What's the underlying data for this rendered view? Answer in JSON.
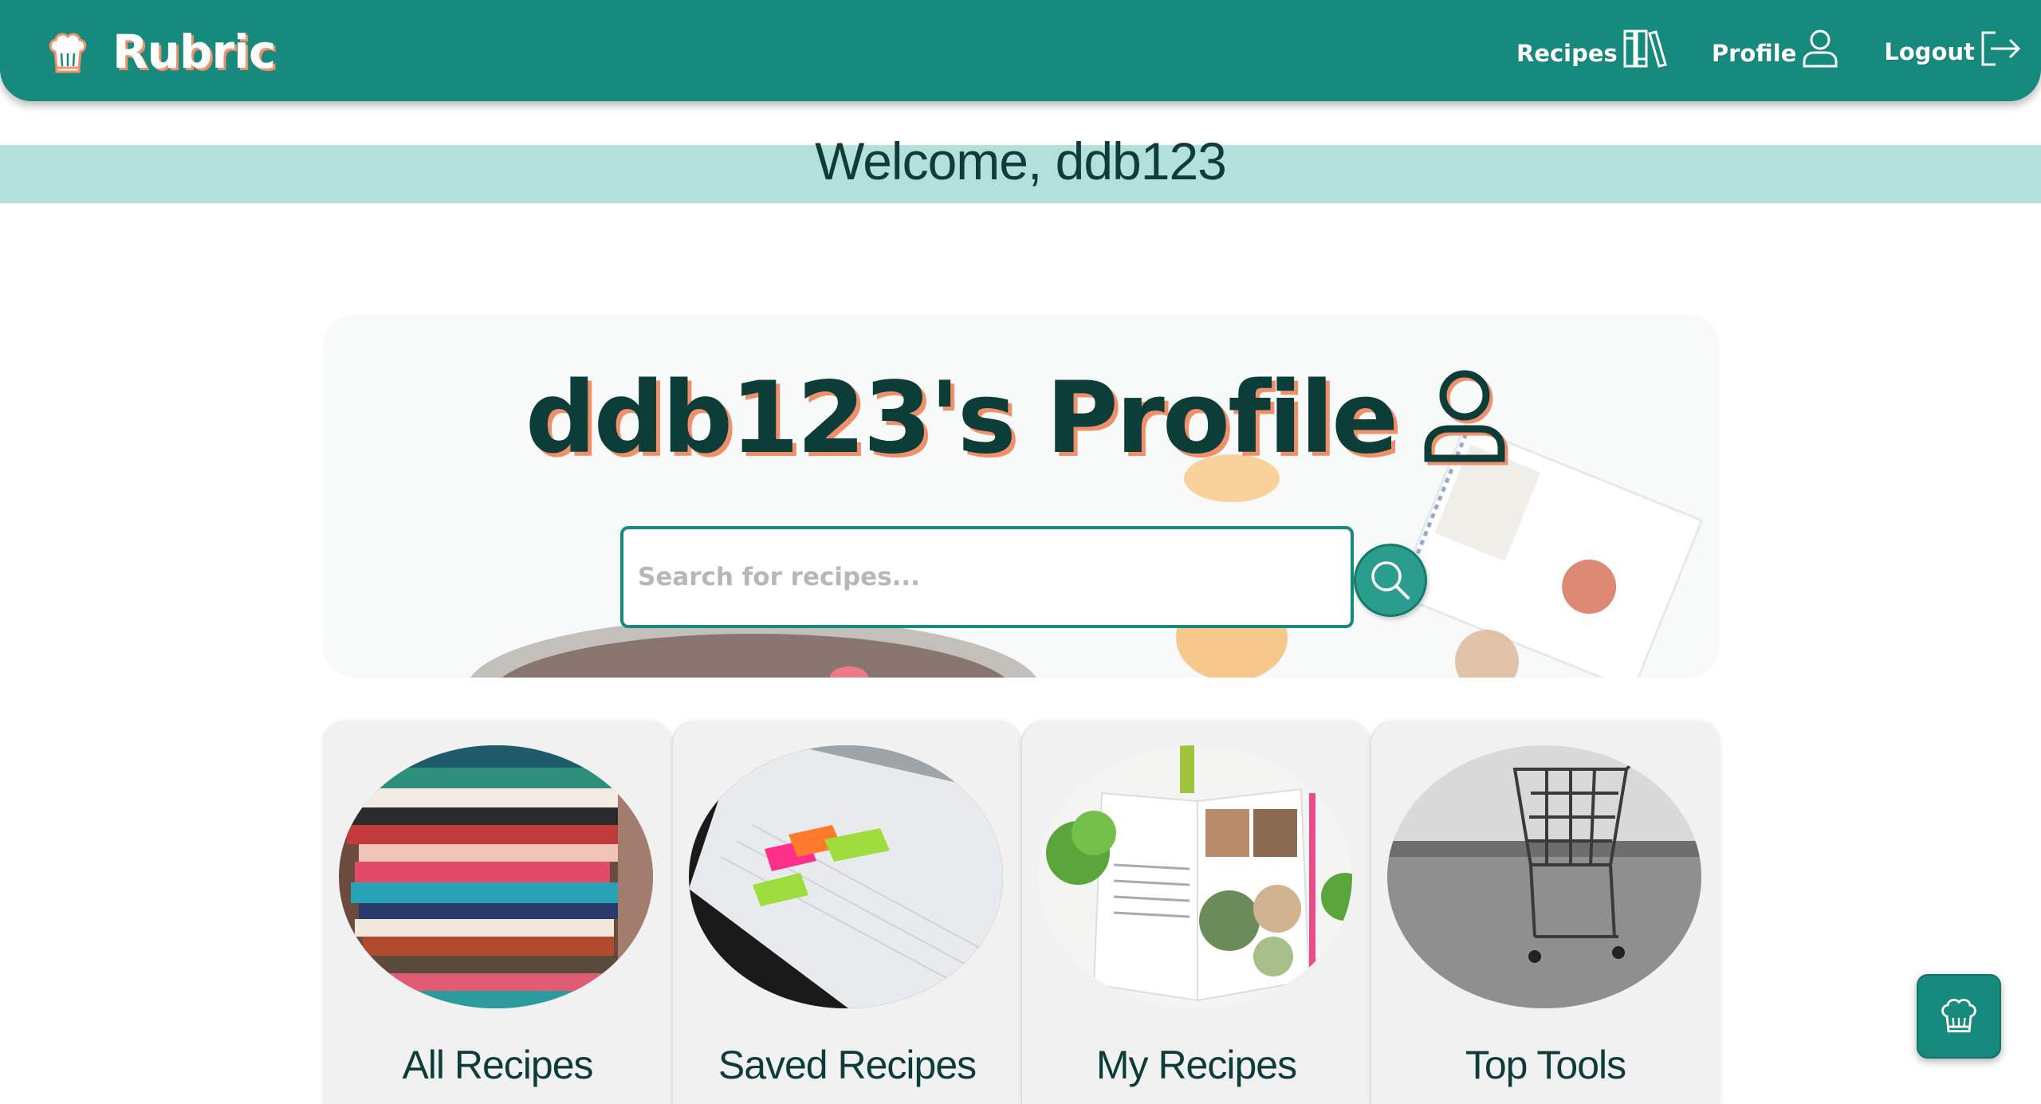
{
  "app": {
    "name": "Rubric",
    "logo_icon": "chef-hat-icon"
  },
  "nav": {
    "recipes_label": "Recipes",
    "profile_label": "Profile",
    "logout_label": "Logout"
  },
  "welcome": {
    "text": "Welcome, ddb123"
  },
  "profile": {
    "title": "ddb123's Profile",
    "search_placeholder": "Search for recipes..."
  },
  "cards": [
    {
      "label": "All Recipes",
      "image": "cookbook-stack"
    },
    {
      "label": "Saved Recipes",
      "image": "bookmarked-pages"
    },
    {
      "label": "My Recipes",
      "image": "open-cookbook"
    },
    {
      "label": "Top Tools",
      "image": "shopping-cart"
    }
  ],
  "colors": {
    "primary": "#168a7d",
    "dark_text": "#0d3d39",
    "accent_shadow": "#f0906a",
    "welcome_bar": "#b4e0db"
  }
}
